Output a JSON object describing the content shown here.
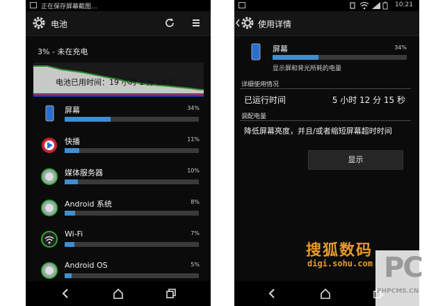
{
  "left": {
    "statusbar": {
      "text": "正在保存屏幕截图..."
    },
    "appbar": {
      "title": "电池"
    },
    "status_line": "3% - 未在充电",
    "usage_time_label": "电池已用时间：19 小时 1 分 58 秒",
    "items": [
      {
        "name": "屏幕",
        "percent_label": "34%",
        "fraction": 0.34,
        "icon": "phone-screen-icon"
      },
      {
        "name": "快播",
        "percent_label": "11%",
        "fraction": 0.11,
        "icon": "kuaibo-icon"
      },
      {
        "name": "媒体服务器",
        "percent_label": "10%",
        "fraction": 0.1,
        "icon": "media-server-icon"
      },
      {
        "name": "Android 系统",
        "percent_label": "8%",
        "fraction": 0.08,
        "icon": "android-system-icon"
      },
      {
        "name": "Wi-Fi",
        "percent_label": "7%",
        "fraction": 0.07,
        "icon": "wifi-icon"
      },
      {
        "name": "Android OS",
        "percent_label": "5%",
        "fraction": 0.05,
        "icon": "android-os-icon"
      }
    ]
  },
  "right": {
    "statusbar": {
      "time": "10:21"
    },
    "appbar": {
      "title": "使用详情"
    },
    "item": {
      "name": "屏幕",
      "percent_label": "34%",
      "fraction": 0.34,
      "description": "显示屏和背光所耗的电量"
    },
    "details_header": "详细使用情况",
    "runtime_label": "已运行时间",
    "runtime_value": "5 小时 12 分 15 秒",
    "adjust_header": "调配电量",
    "advice": "降低屏幕亮度，并且/或者缩短屏幕超时时间",
    "display_button": "显示"
  },
  "watermarks": {
    "sohu_cn": "搜狐数码",
    "sohu_url": "digi.sohu.com",
    "pc_logo": "PC",
    "pc_url": "PHPCMS.CN"
  },
  "colors": {
    "accent_blue": "#3f8fd0",
    "bar_track": "#3a3a3a",
    "graph_fill": "#c8c8c8",
    "graph_line": "#2f8f2f",
    "watermark_orange": "#e89a2a"
  }
}
